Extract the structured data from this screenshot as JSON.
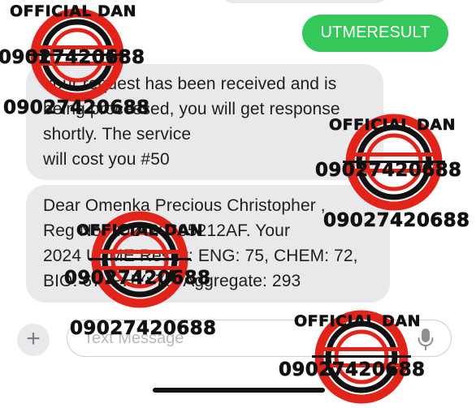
{
  "colors": {
    "outgoing_bubble": "#34c759",
    "incoming_bubble": "#e9e9eb",
    "watermark_red": "#e2231a",
    "watermark_black": "#111111"
  },
  "conversation": {
    "outgoing": {
      "text": "UTMERESULT"
    },
    "incoming": [
      {
        "lines": [
          "Your request has been received and is",
          "being processed, you will get response",
          "shortly. The service",
          "will cost you #50"
        ]
      },
      {
        "lines": [
          "Dear Omenka Precious Christopher ,",
          "Reg No: 202420605212AF. Your",
          "2024 UTME Result: ENG: 75, CHEM: 72,",
          "BIO: 67, PHY: 79, Aggregate: 293"
        ]
      }
    ]
  },
  "compose": {
    "plus_label": "+",
    "placeholder": "Text Message",
    "plus_icon": "plus-icon",
    "mic_icon": "microphone-icon"
  },
  "watermark": {
    "brand": "OFFICIAL DAN",
    "phone": "09027420688",
    "icon": "stamp-logo-icon"
  }
}
